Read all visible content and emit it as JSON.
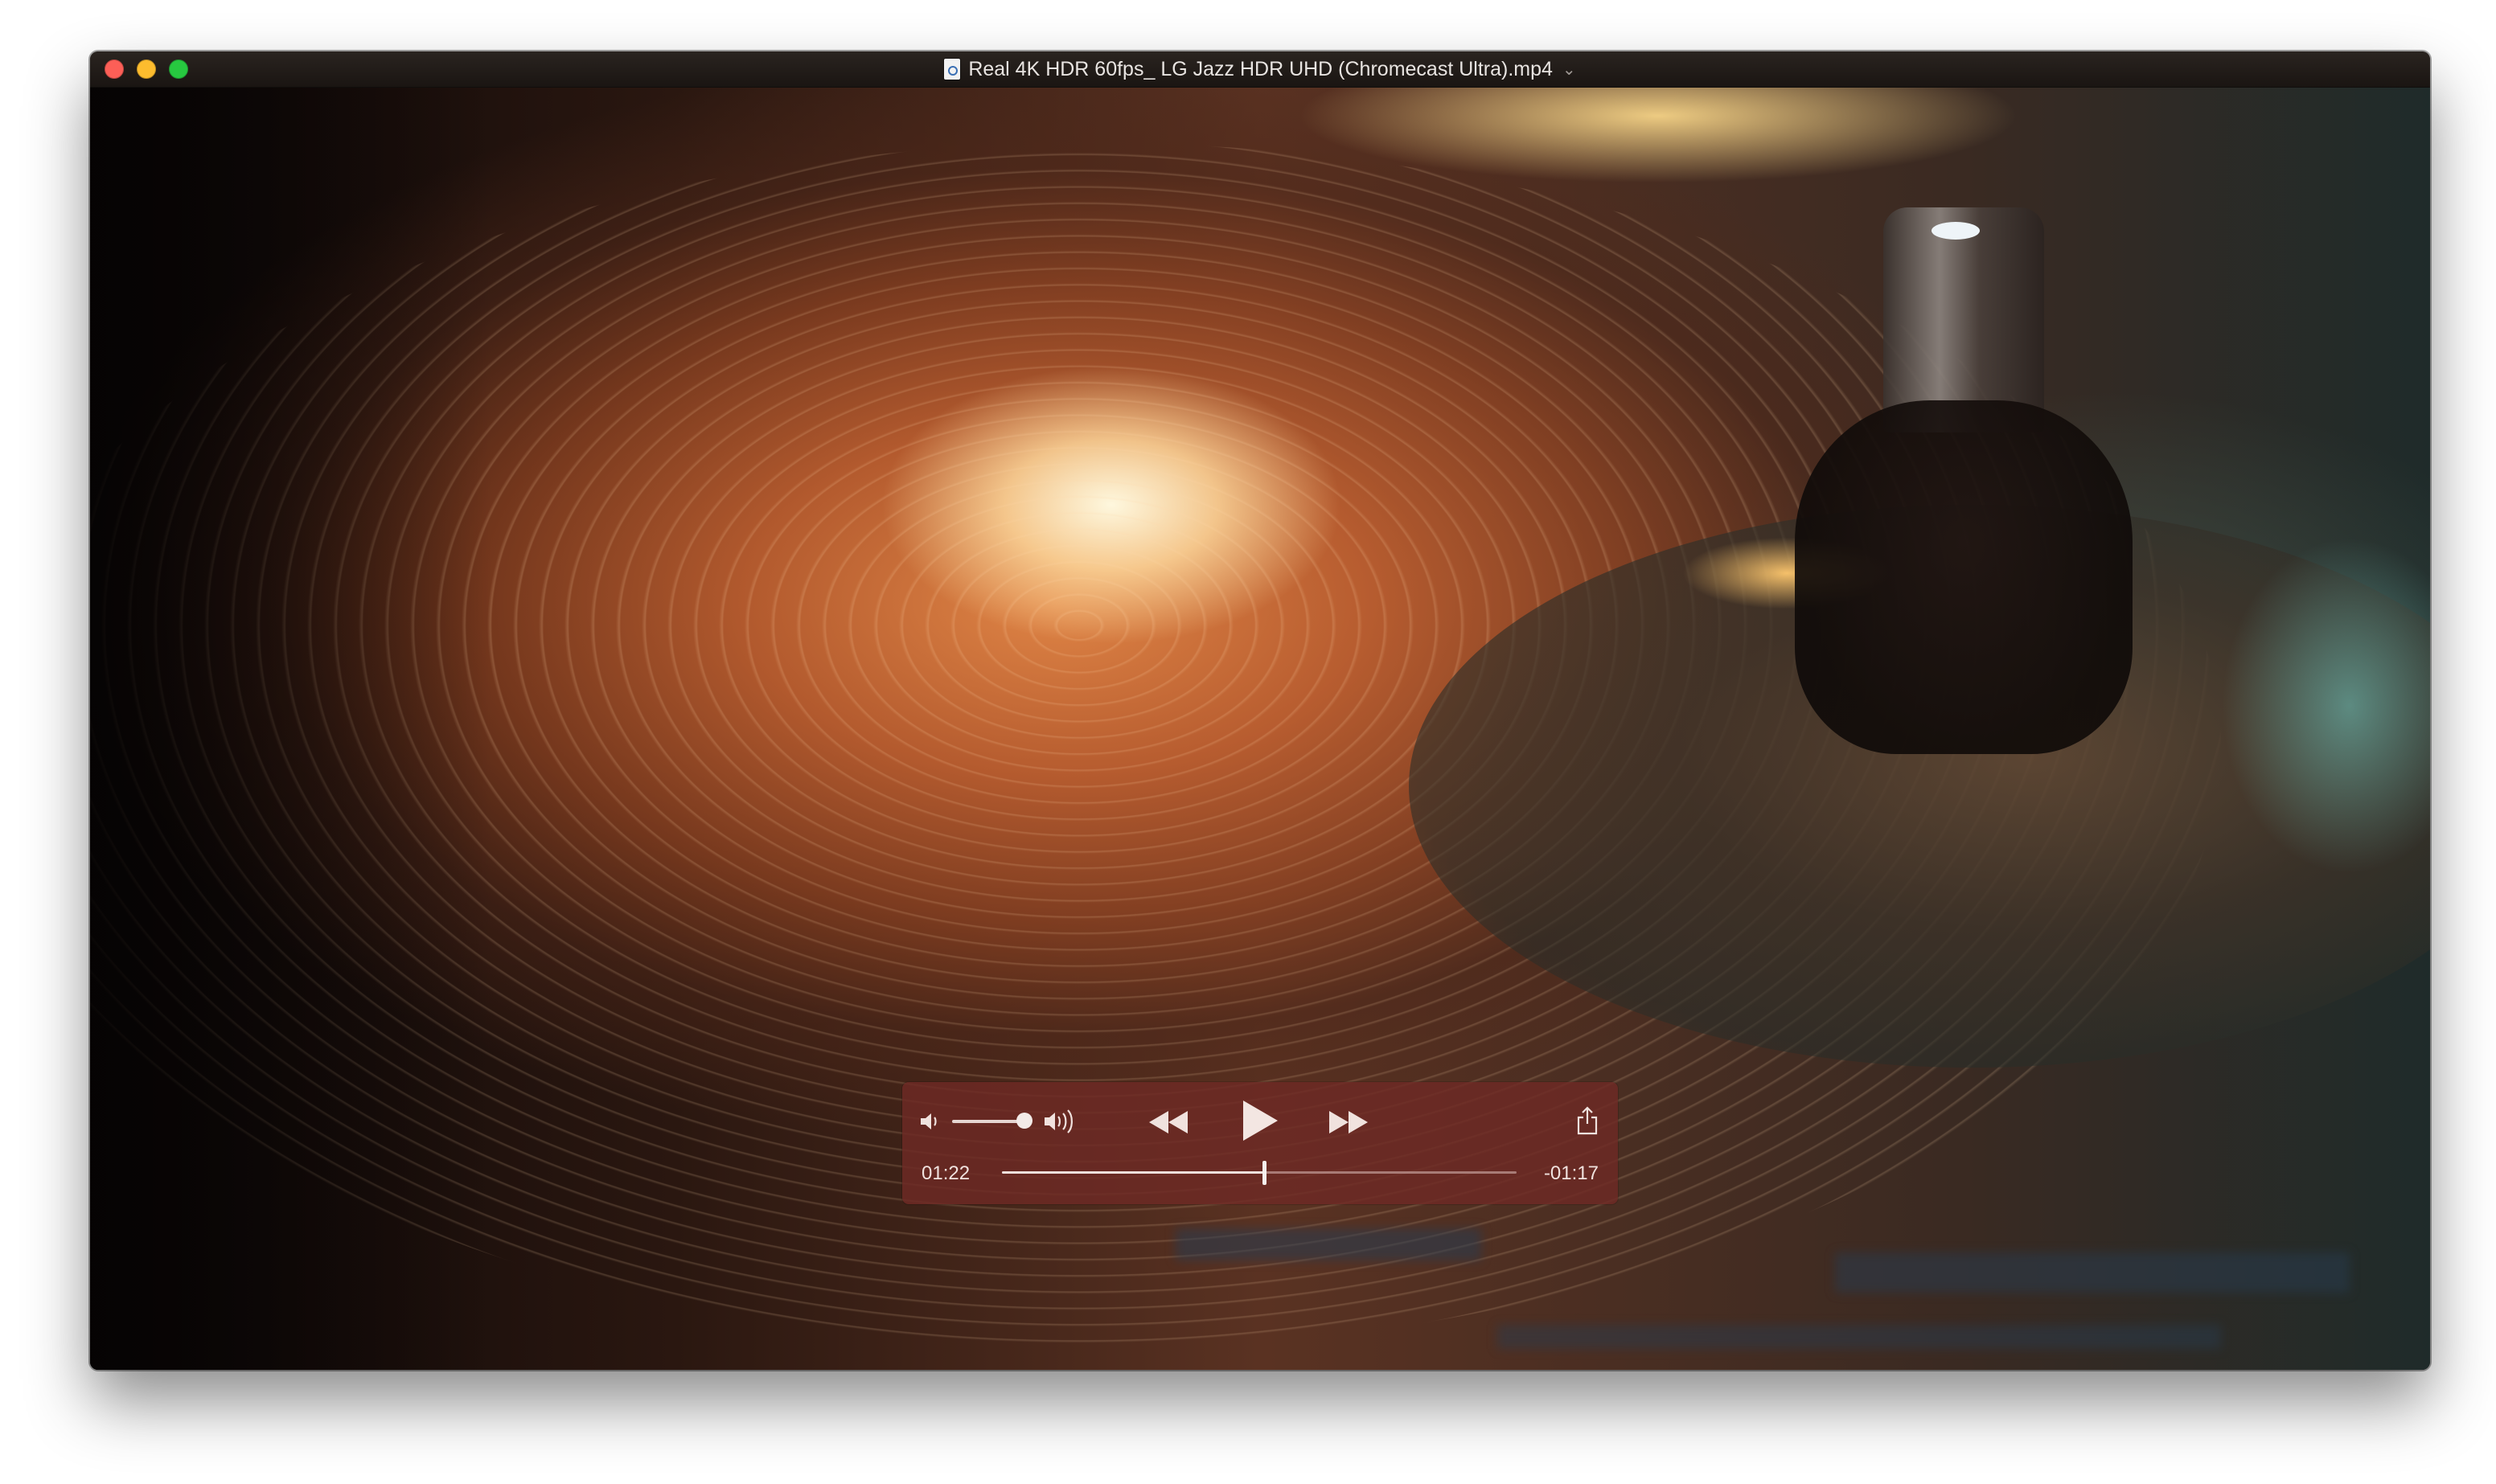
{
  "window": {
    "title": "Real 4K HDR 60fps_ LG Jazz HDR UHD (Chromecast Ultra).mp4",
    "title_chevron": "⌄",
    "traffic_lights": {
      "close": "#fc5f57",
      "minimize": "#fdbc2e",
      "zoom": "#27c840"
    }
  },
  "player": {
    "elapsed": "01:22",
    "remaining": "-01:17",
    "progress_fraction": 0.51,
    "volume_fraction": 0.85,
    "controls_bg": "#6e2a24",
    "icons": {
      "volume_low": "speaker-low-icon",
      "volume_high": "speaker-high-icon",
      "rewind": "rewind-icon",
      "play": "play-icon",
      "fast_forward": "fast-forward-icon",
      "share": "share-icon"
    }
  }
}
